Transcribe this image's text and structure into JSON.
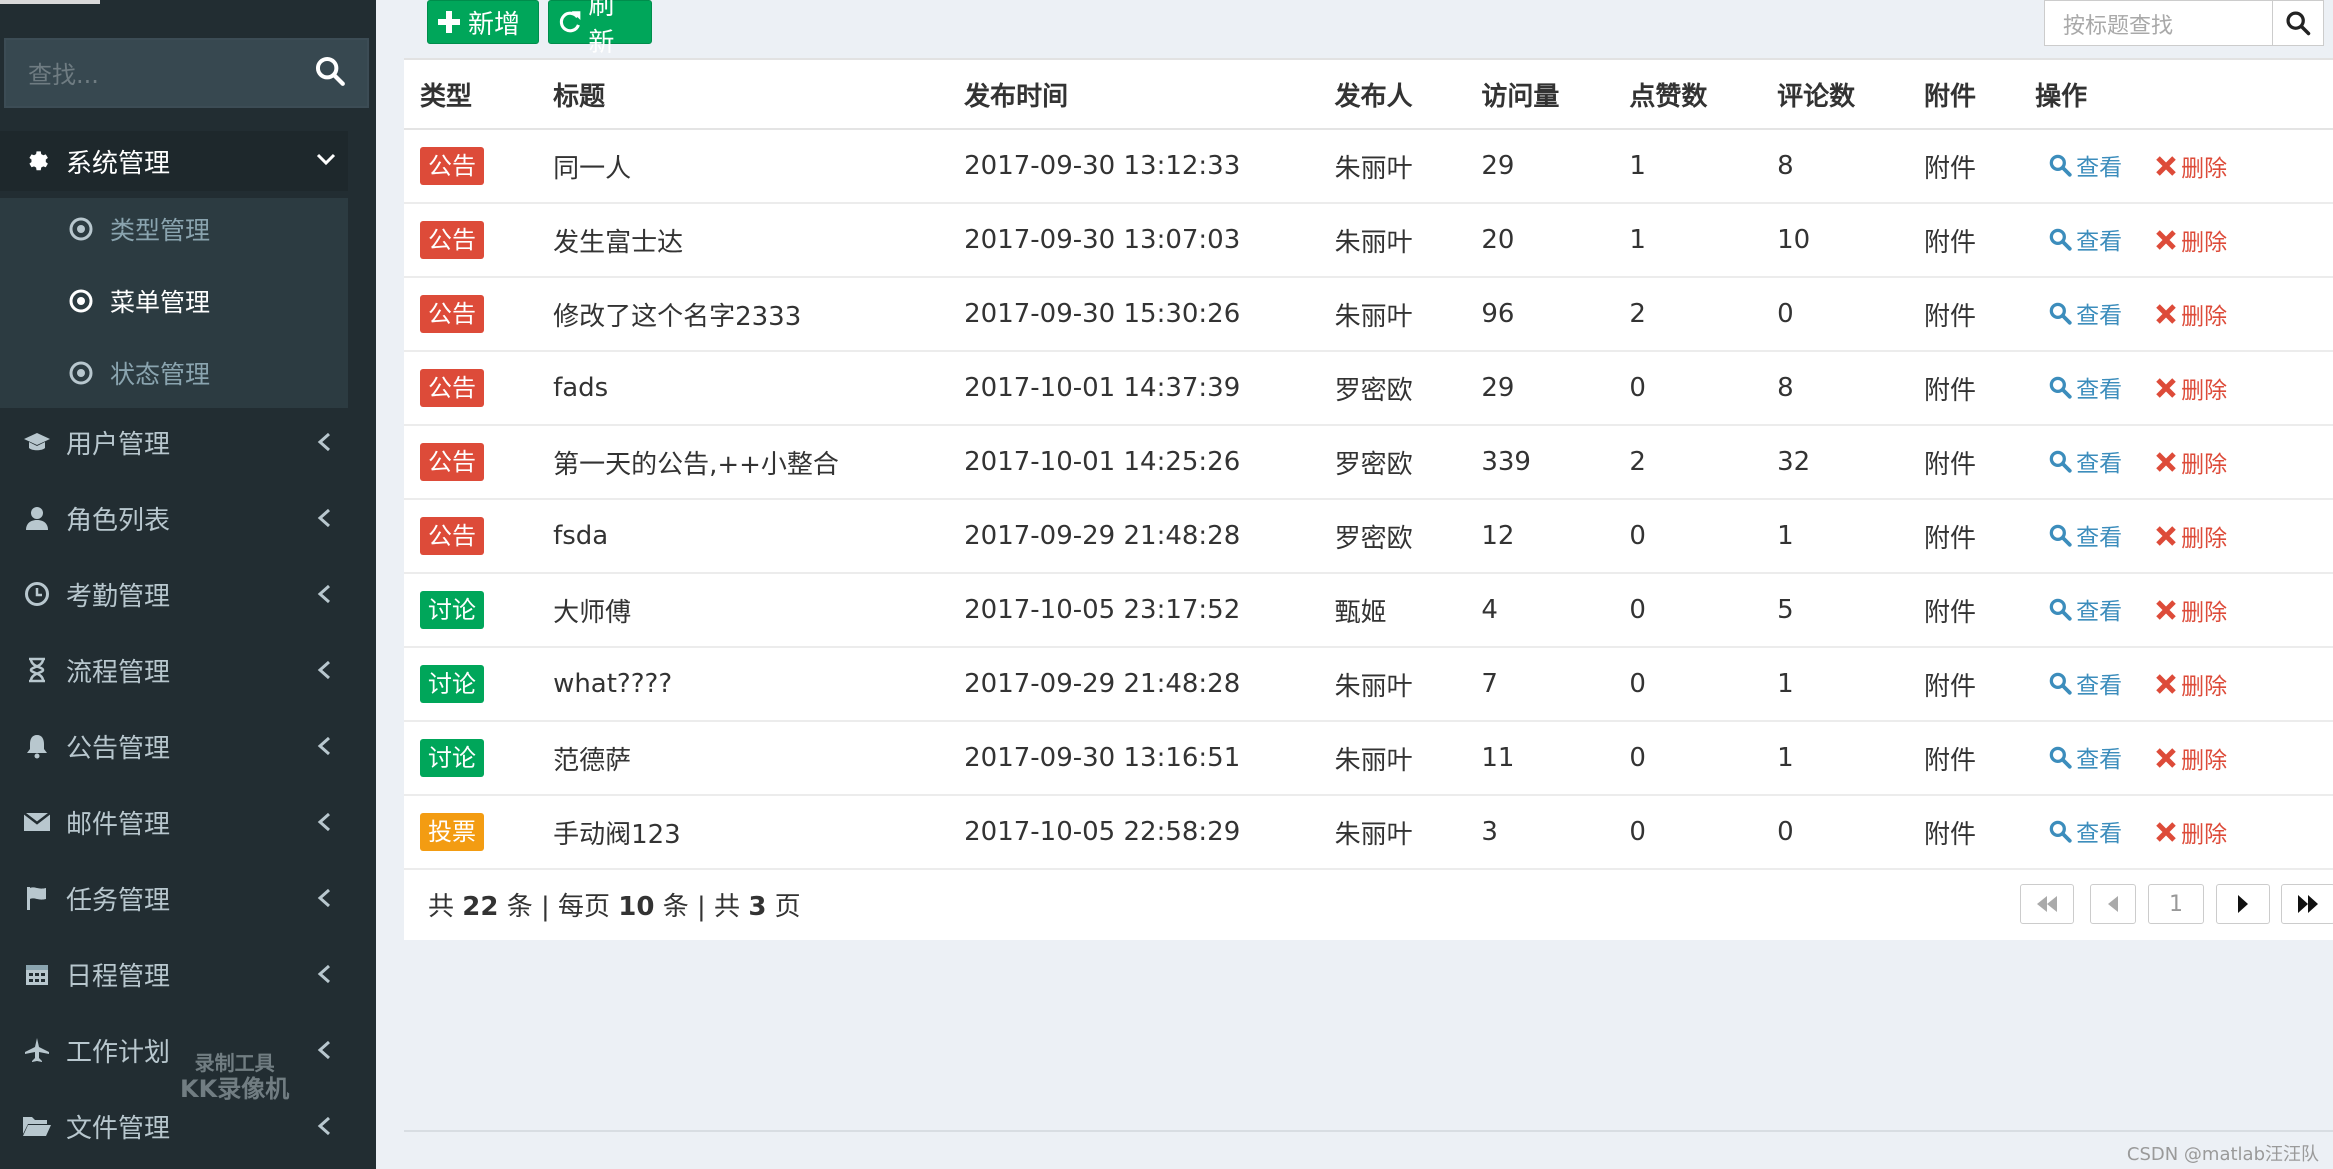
{
  "sidebar": {
    "search_placeholder": "查找...",
    "active_menu": {
      "label": "系统管理",
      "icon": "gear-icon"
    },
    "submenu": [
      {
        "label": "类型管理"
      },
      {
        "label": "菜单管理"
      },
      {
        "label": "状态管理"
      }
    ],
    "menu": [
      {
        "label": "用户管理",
        "icon": "graduation-cap-icon"
      },
      {
        "label": "角色列表",
        "icon": "user-icon"
      },
      {
        "label": "考勤管理",
        "icon": "clock-icon"
      },
      {
        "label": "流程管理",
        "icon": "hourglass-icon"
      },
      {
        "label": "公告管理",
        "icon": "bell-icon"
      },
      {
        "label": "邮件管理",
        "icon": "envelope-icon"
      },
      {
        "label": "任务管理",
        "icon": "flag-icon"
      },
      {
        "label": "日程管理",
        "icon": "calendar-icon"
      },
      {
        "label": "工作计划",
        "icon": "plane-icon"
      },
      {
        "label": "文件管理",
        "icon": "folder-open-icon"
      }
    ],
    "watermark": {
      "line1": "录制工具",
      "line2": "KK录像机"
    }
  },
  "toolbar": {
    "add_label": "新增",
    "refresh_label": "刷新",
    "title_search_placeholder": "按标题查找"
  },
  "table": {
    "headers": [
      "类型",
      "标题",
      "发布时间",
      "发布人",
      "访问量",
      "点赞数",
      "评论数",
      "附件",
      "操作"
    ],
    "rows": [
      {
        "type": "公告",
        "type_color": "#dd4b39",
        "title": "同一人",
        "time": "2017-09-30 13:12:33",
        "author": "朱丽叶",
        "visits": "29",
        "likes": "1",
        "comments": "8",
        "attach": "附件"
      },
      {
        "type": "公告",
        "type_color": "#dd4b39",
        "title": "发生富士达",
        "time": "2017-09-30 13:07:03",
        "author": "朱丽叶",
        "visits": "20",
        "likes": "1",
        "comments": "10",
        "attach": "附件"
      },
      {
        "type": "公告",
        "type_color": "#dd4b39",
        "title": "修改了这个名字2333",
        "time": "2017-09-30 15:30:26",
        "author": "朱丽叶",
        "visits": "96",
        "likes": "2",
        "comments": "0",
        "attach": "附件"
      },
      {
        "type": "公告",
        "type_color": "#dd4b39",
        "title": "fads",
        "time": "2017-10-01 14:37:39",
        "author": "罗密欧",
        "visits": "29",
        "likes": "0",
        "comments": "8",
        "attach": "附件"
      },
      {
        "type": "公告",
        "type_color": "#dd4b39",
        "title": "第一天的公告,++小整合",
        "time": "2017-10-01 14:25:26",
        "author": "罗密欧",
        "visits": "339",
        "likes": "2",
        "comments": "32",
        "attach": "附件"
      },
      {
        "type": "公告",
        "type_color": "#dd4b39",
        "title": "fsda",
        "time": "2017-09-29 21:48:28",
        "author": "罗密欧",
        "visits": "12",
        "likes": "0",
        "comments": "1",
        "attach": "附件"
      },
      {
        "type": "讨论",
        "type_color": "#00a65a",
        "title": "大师傅",
        "time": "2017-10-05 23:17:52",
        "author": "甄姬",
        "visits": "4",
        "likes": "0",
        "comments": "5",
        "attach": "附件"
      },
      {
        "type": "讨论",
        "type_color": "#00a65a",
        "title": "what????",
        "time": "2017-09-29 21:48:28",
        "author": "朱丽叶",
        "visits": "7",
        "likes": "0",
        "comments": "1",
        "attach": "附件"
      },
      {
        "type": "讨论",
        "type_color": "#00a65a",
        "title": "范德萨",
        "time": "2017-09-30 13:16:51",
        "author": "朱丽叶",
        "visits": "11",
        "likes": "0",
        "comments": "1",
        "attach": "附件"
      },
      {
        "type": "投票",
        "type_color": "#f39c12",
        "title": "手动阀123",
        "time": "2017-10-05 22:58:29",
        "author": "朱丽叶",
        "visits": "3",
        "likes": "0",
        "comments": "0",
        "attach": "附件"
      }
    ],
    "view_label": "查看",
    "delete_label": "删除"
  },
  "pager": {
    "prefix": "共",
    "total": "22",
    "unit1": "条 | 每页",
    "per_page": "10",
    "unit2": "条 | 共",
    "pages": "3",
    "unit3": "页",
    "current_page": "1"
  },
  "footer": {
    "credit": "CSDN @matlab汪汪队"
  }
}
